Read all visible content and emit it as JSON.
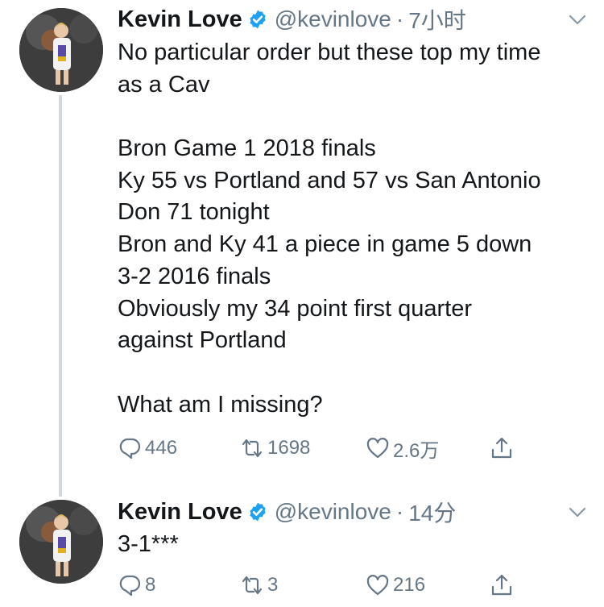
{
  "tweets": [
    {
      "author_name": "Kevin Love",
      "handle": "@kevinlove",
      "separator": "·",
      "time": "7小时",
      "lines": [
        "No particular order but these top my time",
        "as a Cav",
        "",
        "Bron Game 1 2018 finals",
        "Ky 55 vs Portland and 57 vs San Antonio",
        "Don 71 tonight",
        "Bron and Ky 41 a piece in game 5 down",
        "3-2 2016 finals",
        "Obviously my 34 point first quarter",
        "against Portland",
        "",
        "What am I missing?"
      ],
      "replies": "446",
      "retweets": "1698",
      "likes": "2.6万"
    },
    {
      "author_name": "Kevin Love",
      "handle": "@kevinlove",
      "separator": "·",
      "time": "14分",
      "lines": [
        "3-1***"
      ],
      "replies": "8",
      "retweets": "3",
      "likes": "216"
    }
  ],
  "icons": {
    "verified": "verified-badge-icon",
    "caret": "chevron-down-icon",
    "reply": "reply-icon",
    "retweet": "retweet-icon",
    "like": "heart-icon",
    "share": "share-icon"
  },
  "colors": {
    "text": "#14171a",
    "secondary": "#657786",
    "verified": "#1da1f2",
    "thread_line": "#cfd9de"
  }
}
